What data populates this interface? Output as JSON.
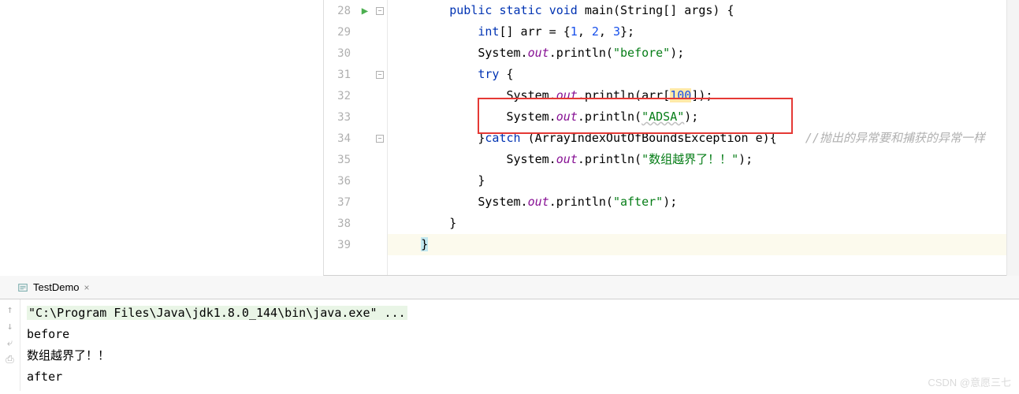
{
  "gutter": {
    "lines": [
      "28",
      "29",
      "30",
      "31",
      "32",
      "33",
      "34",
      "35",
      "36",
      "37",
      "38",
      "39"
    ],
    "run_marker_line": 0
  },
  "code": {
    "l28": {
      "kw1": "public",
      "kw2": "static",
      "kw3": "void",
      "name": "main",
      "sig": "(String[] args) {"
    },
    "l29": {
      "kw": "int",
      "arr": "[] arr = {",
      "n1": "1",
      "n2": "2",
      "n3": "3",
      "end": "};"
    },
    "l30": {
      "pre": "System.",
      "out": "out",
      "mid": ".println(",
      "str": "\"before\"",
      "end": ");"
    },
    "l31": {
      "kw": "try",
      "brace": " {"
    },
    "l32": {
      "pre": "System.",
      "out": "out",
      "mid": ".println(arr[",
      "idx": "100",
      "end": "]);"
    },
    "l33": {
      "pre": "System.",
      "out": "out",
      "mid": ".println(",
      "str": "\"ADSA\"",
      "end": ");"
    },
    "l34": {
      "brace": "}",
      "kw": "catch",
      "sig": " (ArrayIndexOutOfBoundsException e){",
      "comment": "//抛出的异常要和捕获的异常一样"
    },
    "l35": {
      "pre": "System.",
      "out": "out",
      "mid": ".println(",
      "str": "\"数组越界了！！\"",
      "end": ");"
    },
    "l36": {
      "brace": "}"
    },
    "l37": {
      "pre": "System.",
      "out": "out",
      "mid": ".println(",
      "str": "\"after\"",
      "end": ");"
    },
    "l38": {
      "brace": "}"
    },
    "l39": {
      "brace": "}"
    }
  },
  "tab": {
    "name": "TestDemo"
  },
  "console": {
    "cmd": "\"C:\\Program Files\\Java\\jdk1.8.0_144\\bin\\java.exe\" ...",
    "out1": "before",
    "out2": "数组越界了！！",
    "out3": "after"
  },
  "watermark": "CSDN @意愿三七"
}
